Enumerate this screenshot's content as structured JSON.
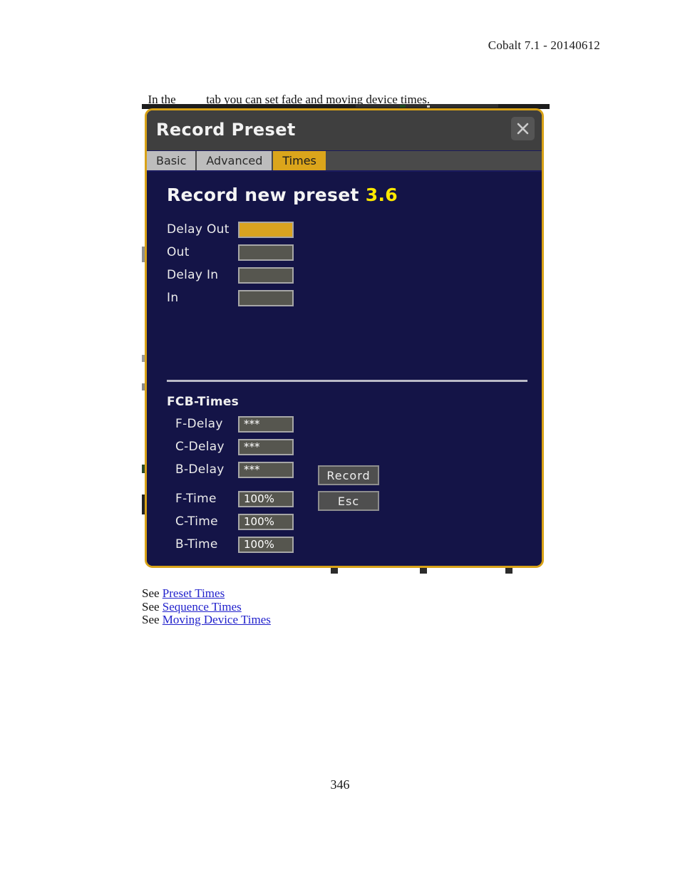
{
  "document": {
    "header": "Cobalt 7.1 - 20140612",
    "intro_prefix": "In the",
    "intro_suffix": "tab you can set fade and moving device times.",
    "page_number": "346"
  },
  "dialog": {
    "title": "Record Preset",
    "close_icon": "close-icon",
    "tabs": [
      {
        "label": "Basic",
        "active": false
      },
      {
        "label": "Advanced",
        "active": false
      },
      {
        "label": "Times",
        "active": true
      }
    ],
    "heading": {
      "text": "Record new preset",
      "number": "3.6"
    },
    "fade_fields": [
      {
        "label": "Delay Out",
        "value": "",
        "highlight": true
      },
      {
        "label": "Out",
        "value": "",
        "highlight": false
      },
      {
        "label": "Delay In",
        "value": "",
        "highlight": false
      },
      {
        "label": "In",
        "value": "",
        "highlight": false
      }
    ],
    "fcb": {
      "section_title": "FCB-Times",
      "delay_fields": [
        {
          "label": "F-Delay",
          "value": "***"
        },
        {
          "label": "C-Delay",
          "value": "***"
        },
        {
          "label": "B-Delay",
          "value": "***"
        }
      ],
      "time_fields": [
        {
          "label": "F-Time",
          "value": "100%"
        },
        {
          "label": "C-Time",
          "value": "100%"
        },
        {
          "label": "B-Time",
          "value": "100%"
        }
      ]
    },
    "buttons": {
      "record": "Record",
      "esc": "Esc"
    },
    "colors": {
      "border": "#d8a217",
      "body_bg": "#141447",
      "titlebar_bg": "#3f3f3f",
      "active_tab": "#dba51b",
      "highlight_field": "#d9a320",
      "field_bg": "#56564f",
      "heading_number": "#ffe800"
    }
  },
  "see_links": [
    {
      "prefix": "See",
      "label": "Preset Times"
    },
    {
      "prefix": "See",
      "label": "Sequence Times"
    },
    {
      "prefix": "See",
      "label": "Moving Device Times"
    }
  ]
}
